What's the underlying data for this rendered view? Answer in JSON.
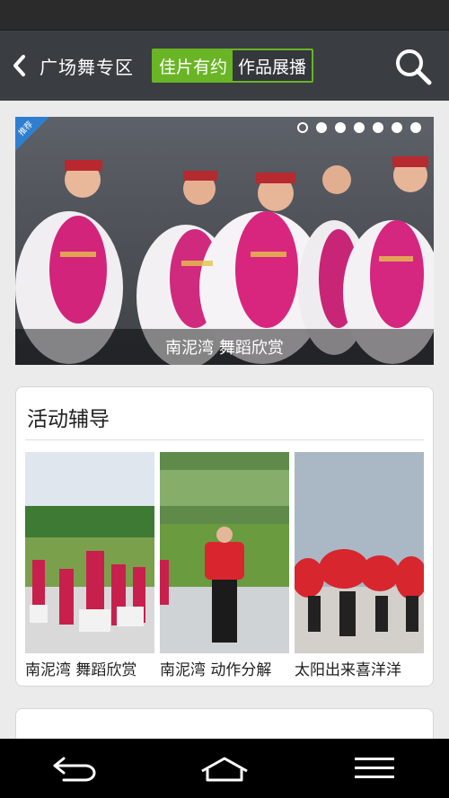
{
  "header": {
    "title": "广场舞专区",
    "tabs": [
      {
        "label": "佳片有约",
        "active": true
      },
      {
        "label": "作品展播",
        "active": false
      }
    ]
  },
  "banner": {
    "badge": "推荐",
    "caption": "南泥湾 舞蹈欣赏",
    "dots_total": 7,
    "active_dot": 1
  },
  "activity": {
    "title": "活动辅导",
    "items": [
      {
        "label": "南泥湾 舞蹈欣赏"
      },
      {
        "label": "南泥湾 动作分解"
      },
      {
        "label": "太阳出来喜洋洋"
      }
    ]
  },
  "colors": {
    "accent": "#6ab526",
    "header_bg": "#3a3d41",
    "page_bg": "#ebebeb"
  }
}
